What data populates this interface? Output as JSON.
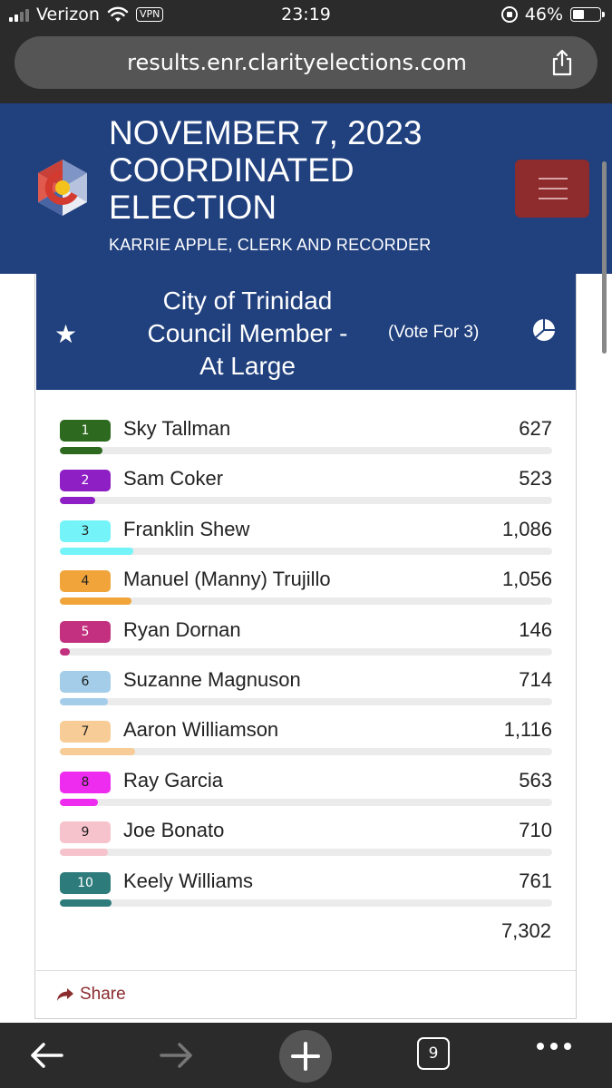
{
  "status_bar": {
    "carrier": "Verizon",
    "vpn": "VPN",
    "time": "23:19",
    "battery": "46%",
    "battery_level": 0.46
  },
  "browser": {
    "url": "results.enr.clarityelections.com",
    "open_tabs": "9"
  },
  "header": {
    "title_lines": [
      "NOVEMBER 7, 2023",
      "COORDINATED",
      "ELECTION"
    ],
    "subtitle": "KARRIE APPLE, CLERK AND RECORDER"
  },
  "contest": {
    "title_lines": [
      "City of Trinidad",
      "Council Member -",
      "At Large"
    ],
    "vote_for": "(Vote For 3)",
    "total_votes": "7,302",
    "share_label": "Share",
    "candidates": [
      {
        "number": "1",
        "name": "Sky Tallman",
        "votes": "627",
        "percent": 8.59,
        "color": "#2d6a1f",
        "badge_text": "#ffffff"
      },
      {
        "number": "2",
        "name": "Sam Coker",
        "votes": "523",
        "percent": 7.16,
        "color": "#8e1fc4",
        "badge_text": "#ffffff"
      },
      {
        "number": "3",
        "name": "Franklin Shew",
        "votes": "1,086",
        "percent": 14.87,
        "color": "#74f4f8",
        "badge_text": "#222222"
      },
      {
        "number": "4",
        "name": "Manuel (Manny) Trujillo",
        "votes": "1,056",
        "percent": 14.46,
        "color": "#f0a43a",
        "badge_text": "#222222"
      },
      {
        "number": "5",
        "name": "Ryan Dornan",
        "votes": "146",
        "percent": 2.0,
        "color": "#c2307f",
        "badge_text": "#ffffff"
      },
      {
        "number": "6",
        "name": "Suzanne Magnuson",
        "votes": "714",
        "percent": 9.78,
        "color": "#a3cde9",
        "badge_text": "#222222"
      },
      {
        "number": "7",
        "name": "Aaron Williamson",
        "votes": "1,116",
        "percent": 15.28,
        "color": "#f7cc96",
        "badge_text": "#222222"
      },
      {
        "number": "8",
        "name": "Ray Garcia",
        "votes": "563",
        "percent": 7.71,
        "color": "#ee2cf0",
        "badge_text": "#222222"
      },
      {
        "number": "9",
        "name": "Joe Bonato",
        "votes": "710",
        "percent": 9.72,
        "color": "#f6c2cb",
        "badge_text": "#222222"
      },
      {
        "number": "10",
        "name": "Keely Williams",
        "votes": "761",
        "percent": 10.42,
        "color": "#2e7b7b",
        "badge_text": "#ffffff"
      }
    ]
  },
  "colors": {
    "header_blue": "#20407e",
    "menu_red": "#8d2b2d",
    "share_red": "#8a2b2d"
  }
}
